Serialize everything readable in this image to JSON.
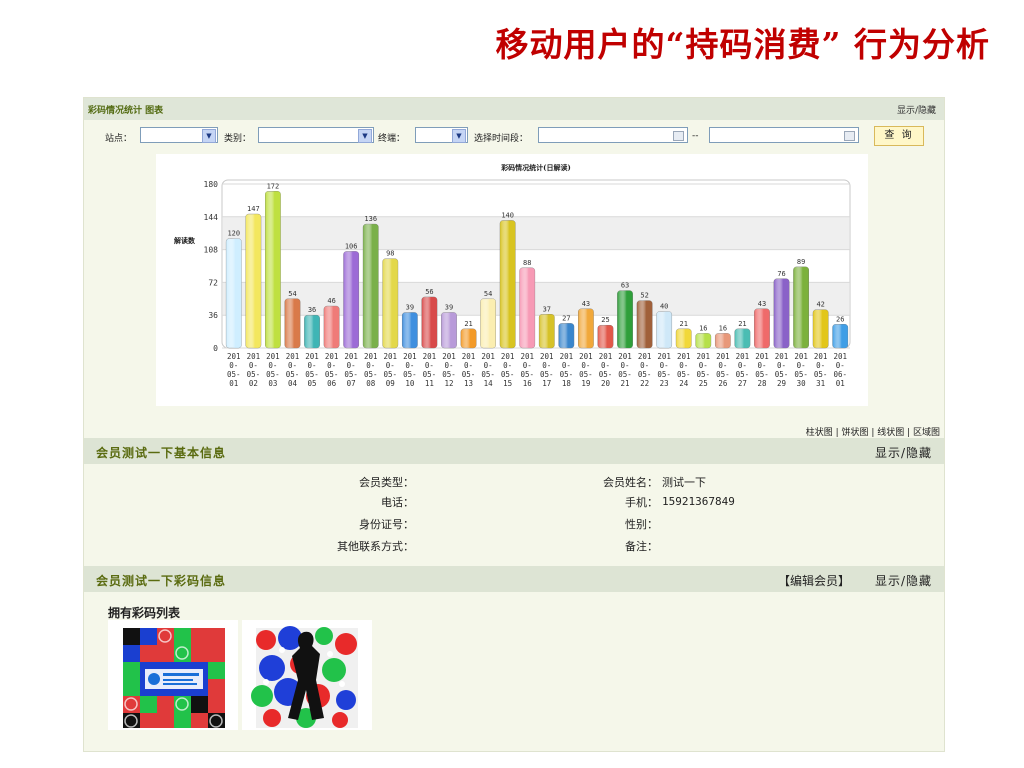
{
  "slide": {
    "title": "移动用户的“持码消费” 行为分析"
  },
  "stat_panel": {
    "title": "彩码情况统计 图表",
    "toggle": "显示/隐藏",
    "filters": {
      "site_label": "站点：",
      "type_label": "类别：",
      "terminal_label": "终端：",
      "time_label": "选择时间段：",
      "range_sep": "--",
      "query": "查 询"
    },
    "chart_type_links": "柱状图 | 饼状图 | 线状图 | 区域图"
  },
  "chart_data": {
    "type": "bar",
    "title": "彩码情况统计(日解读)",
    "ylabel": "解读数",
    "ylim": [
      0,
      180
    ],
    "yticks": [
      0,
      36,
      72,
      108,
      144,
      180
    ],
    "categories": [
      [
        "201",
        "0-",
        "05-",
        "01"
      ],
      [
        "201",
        "0-",
        "05-",
        "02"
      ],
      [
        "201",
        "0-",
        "05-",
        "03"
      ],
      [
        "201",
        "0-",
        "05-",
        "04"
      ],
      [
        "201",
        "0-",
        "05-",
        "05"
      ],
      [
        "201",
        "0-",
        "05-",
        "06"
      ],
      [
        "201",
        "0-",
        "05-",
        "07"
      ],
      [
        "201",
        "0-",
        "05-",
        "08"
      ],
      [
        "201",
        "0-",
        "05-",
        "09"
      ],
      [
        "201",
        "0-",
        "05-",
        "10"
      ],
      [
        "201",
        "0-",
        "05-",
        "11"
      ],
      [
        "201",
        "0-",
        "05-",
        "12"
      ],
      [
        "201",
        "0-",
        "05-",
        "13"
      ],
      [
        "201",
        "0-",
        "05-",
        "14"
      ],
      [
        "201",
        "0-",
        "05-",
        "15"
      ],
      [
        "201",
        "0-",
        "05-",
        "16"
      ],
      [
        "201",
        "0-",
        "05-",
        "17"
      ],
      [
        "201",
        "0-",
        "05-",
        "18"
      ],
      [
        "201",
        "0-",
        "05-",
        "19"
      ],
      [
        "201",
        "0-",
        "05-",
        "20"
      ],
      [
        "201",
        "0-",
        "05-",
        "21"
      ],
      [
        "201",
        "0-",
        "05-",
        "22"
      ],
      [
        "201",
        "0-",
        "05-",
        "23"
      ],
      [
        "201",
        "0-",
        "05-",
        "24"
      ],
      [
        "201",
        "0-",
        "05-",
        "25"
      ],
      [
        "201",
        "0-",
        "05-",
        "26"
      ],
      [
        "201",
        "0-",
        "05-",
        "27"
      ],
      [
        "201",
        "0-",
        "05-",
        "28"
      ],
      [
        "201",
        "0-",
        "05-",
        "29"
      ],
      [
        "201",
        "0-",
        "05-",
        "30"
      ],
      [
        "201",
        "0-",
        "05-",
        "31"
      ],
      [
        "201",
        "0-",
        "06-",
        "01"
      ]
    ],
    "values": [
      120,
      147,
      172,
      54,
      36,
      46,
      106,
      136,
      98,
      39,
      56,
      39,
      21,
      54,
      140,
      88,
      37,
      27,
      43,
      25,
      63,
      52,
      40,
      21,
      16,
      16,
      21,
      43,
      76,
      89,
      42,
      26
    ],
    "colors": [
      "#cfeeff",
      "#f3e75e",
      "#bfe040",
      "#d97a4a",
      "#3fb5b5",
      "#ef7b78",
      "#9c6bd6",
      "#7ab04a",
      "#e3d84a",
      "#3f8fdf",
      "#d84a4a",
      "#b89ad9",
      "#f39a28",
      "#fbeeb0",
      "#d8c420",
      "#f79ab5",
      "#d6c228",
      "#3a86cc",
      "#f1a83a",
      "#e2584a",
      "#2f9f3a",
      "#a0603a",
      "#cfe8f8",
      "#f1d83a",
      "#b6e04a",
      "#e8987a",
      "#4bbdb3",
      "#ef6a6a",
      "#8a62c8",
      "#7cb13c",
      "#e2c61a",
      "#3f9ee6"
    ],
    "grid": true,
    "legend": "none"
  },
  "member_info": {
    "title": "会员测试一下基本信息",
    "toggle": "显示/隐藏",
    "fields": {
      "member_type_label": "会员类型：",
      "phone_label": "电话：",
      "id_label": "身份证号：",
      "other_label": "其他联系方式：",
      "name_label": "会员姓名：",
      "name_value": "测试一下",
      "mobile_label": "手机：",
      "mobile_value": "15921367849",
      "gender_label": "性别：",
      "note_label": "备注："
    }
  },
  "codes_section": {
    "title": "会员测试一下彩码信息",
    "edit": "【编辑会员】",
    "toggle": "显示/隐藏",
    "list_title": "拥有彩码列表"
  }
}
